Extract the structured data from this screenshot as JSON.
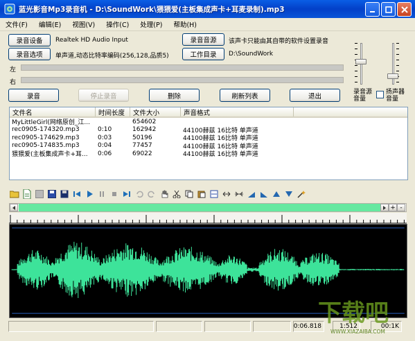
{
  "window": {
    "title": "蓝光影音Mp3录音机 - D:\\SoundWork\\猥猥爱(主板集成声卡+耳麦录制).mp3"
  },
  "menu": [
    {
      "label": "文件(F)"
    },
    {
      "label": "编辑(E)"
    },
    {
      "label": "视图(V)"
    },
    {
      "label": "操作(C)"
    },
    {
      "label": "处理(P)"
    },
    {
      "label": "帮助(H)"
    }
  ],
  "settings": {
    "device_button": "录音设备",
    "device_value": "Realtek HD Audio Input",
    "source_button": "录音音源",
    "source_hint": "该声卡只能由其自带的软件设置录音",
    "options_button": "录音选项",
    "options_value": "单声道,动态比特率编码(256,128,品质5)",
    "workdir_button": "工作目录",
    "workdir_value": "D:\\SoundWork"
  },
  "meters": {
    "left_label": "左",
    "right_label": "右",
    "left_level": 0,
    "right_level": 0
  },
  "volume": {
    "source_label": "录音源\n音量",
    "speaker_label": "扬声器\n音量",
    "source_level": 0.55,
    "speaker_level": 0.15
  },
  "actions": {
    "record": "录音",
    "stop": "停止录音",
    "delete": "删除",
    "refresh": "刷新列表",
    "exit": "退出"
  },
  "file_list": {
    "columns": [
      "文件名",
      "时间长度",
      "文件大小",
      "声音格式"
    ],
    "rows": [
      [
        "MyLittleGirl(网络原创_江...",
        "",
        "654602",
        ""
      ],
      [
        "rec0905-174320.mp3",
        "0:10",
        "162942",
        "44100赫兹 16比特 单声道"
      ],
      [
        "rec0905-174629.mp3",
        "0:03",
        "50196",
        "44100赫兹 16比特 单声道"
      ],
      [
        "rec0905-174835.mp3",
        "0:04",
        "77457",
        "44100赫兹 16比特 单声道"
      ],
      [
        "猥猥爱(主板集成声卡+耳...",
        "0:06",
        "69022",
        "44100赫兹 16比特 单声道"
      ]
    ]
  },
  "scroll": {
    "plus": "+",
    "minus": "-"
  },
  "status": {
    "time": "0:06.818",
    "sample_rate": "1:512",
    "extra": "00:1K"
  },
  "watermark": {
    "text": "下载吧",
    "url": "WWW.XIAZAIBA.COM"
  },
  "colors": {
    "wave": "#3DE39A",
    "meter": "#3BD17A",
    "title": "#0A5EE5"
  }
}
